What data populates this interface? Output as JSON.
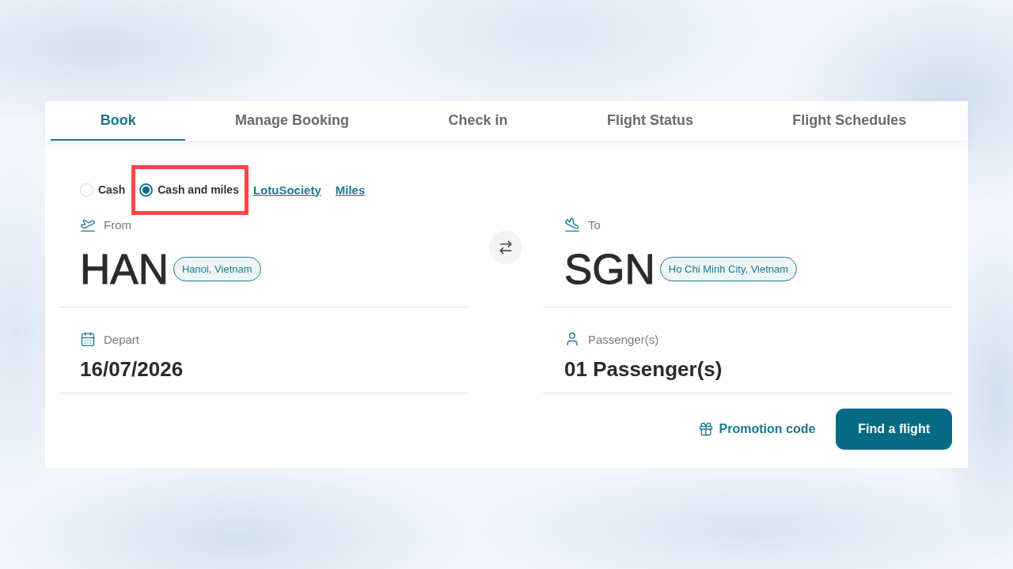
{
  "tabs": [
    {
      "label": "Book",
      "selected": true
    },
    {
      "label": "Manage Booking",
      "selected": false
    },
    {
      "label": "Check in",
      "selected": false
    },
    {
      "label": "Flight Status",
      "selected": false
    },
    {
      "label": "Flight Schedules",
      "selected": false
    }
  ],
  "fare_options": [
    {
      "kind": "radio",
      "label": "Cash",
      "selected": false,
      "highlighted": false
    },
    {
      "kind": "radio",
      "label": "Cash and miles",
      "selected": true,
      "highlighted": true
    },
    {
      "kind": "link",
      "label": "LotuSociety"
    },
    {
      "kind": "link",
      "label": "Miles"
    }
  ],
  "route": [
    {
      "kind": "origin",
      "label": "From",
      "code": "HAN",
      "city": "Hanoi, Vietnam"
    },
    {
      "kind": "destination",
      "label": "To",
      "code": "SGN",
      "city": "Ho Chi Minh City, Vietnam"
    }
  ],
  "details": [
    {
      "kind": "date",
      "label": "Depart",
      "value": "16/07/2026"
    },
    {
      "kind": "passengers",
      "label": "Passenger(s)",
      "value": "01 Passenger(s)"
    }
  ],
  "promotion_link": "Promotion code",
  "search_button": "Find a flight"
}
